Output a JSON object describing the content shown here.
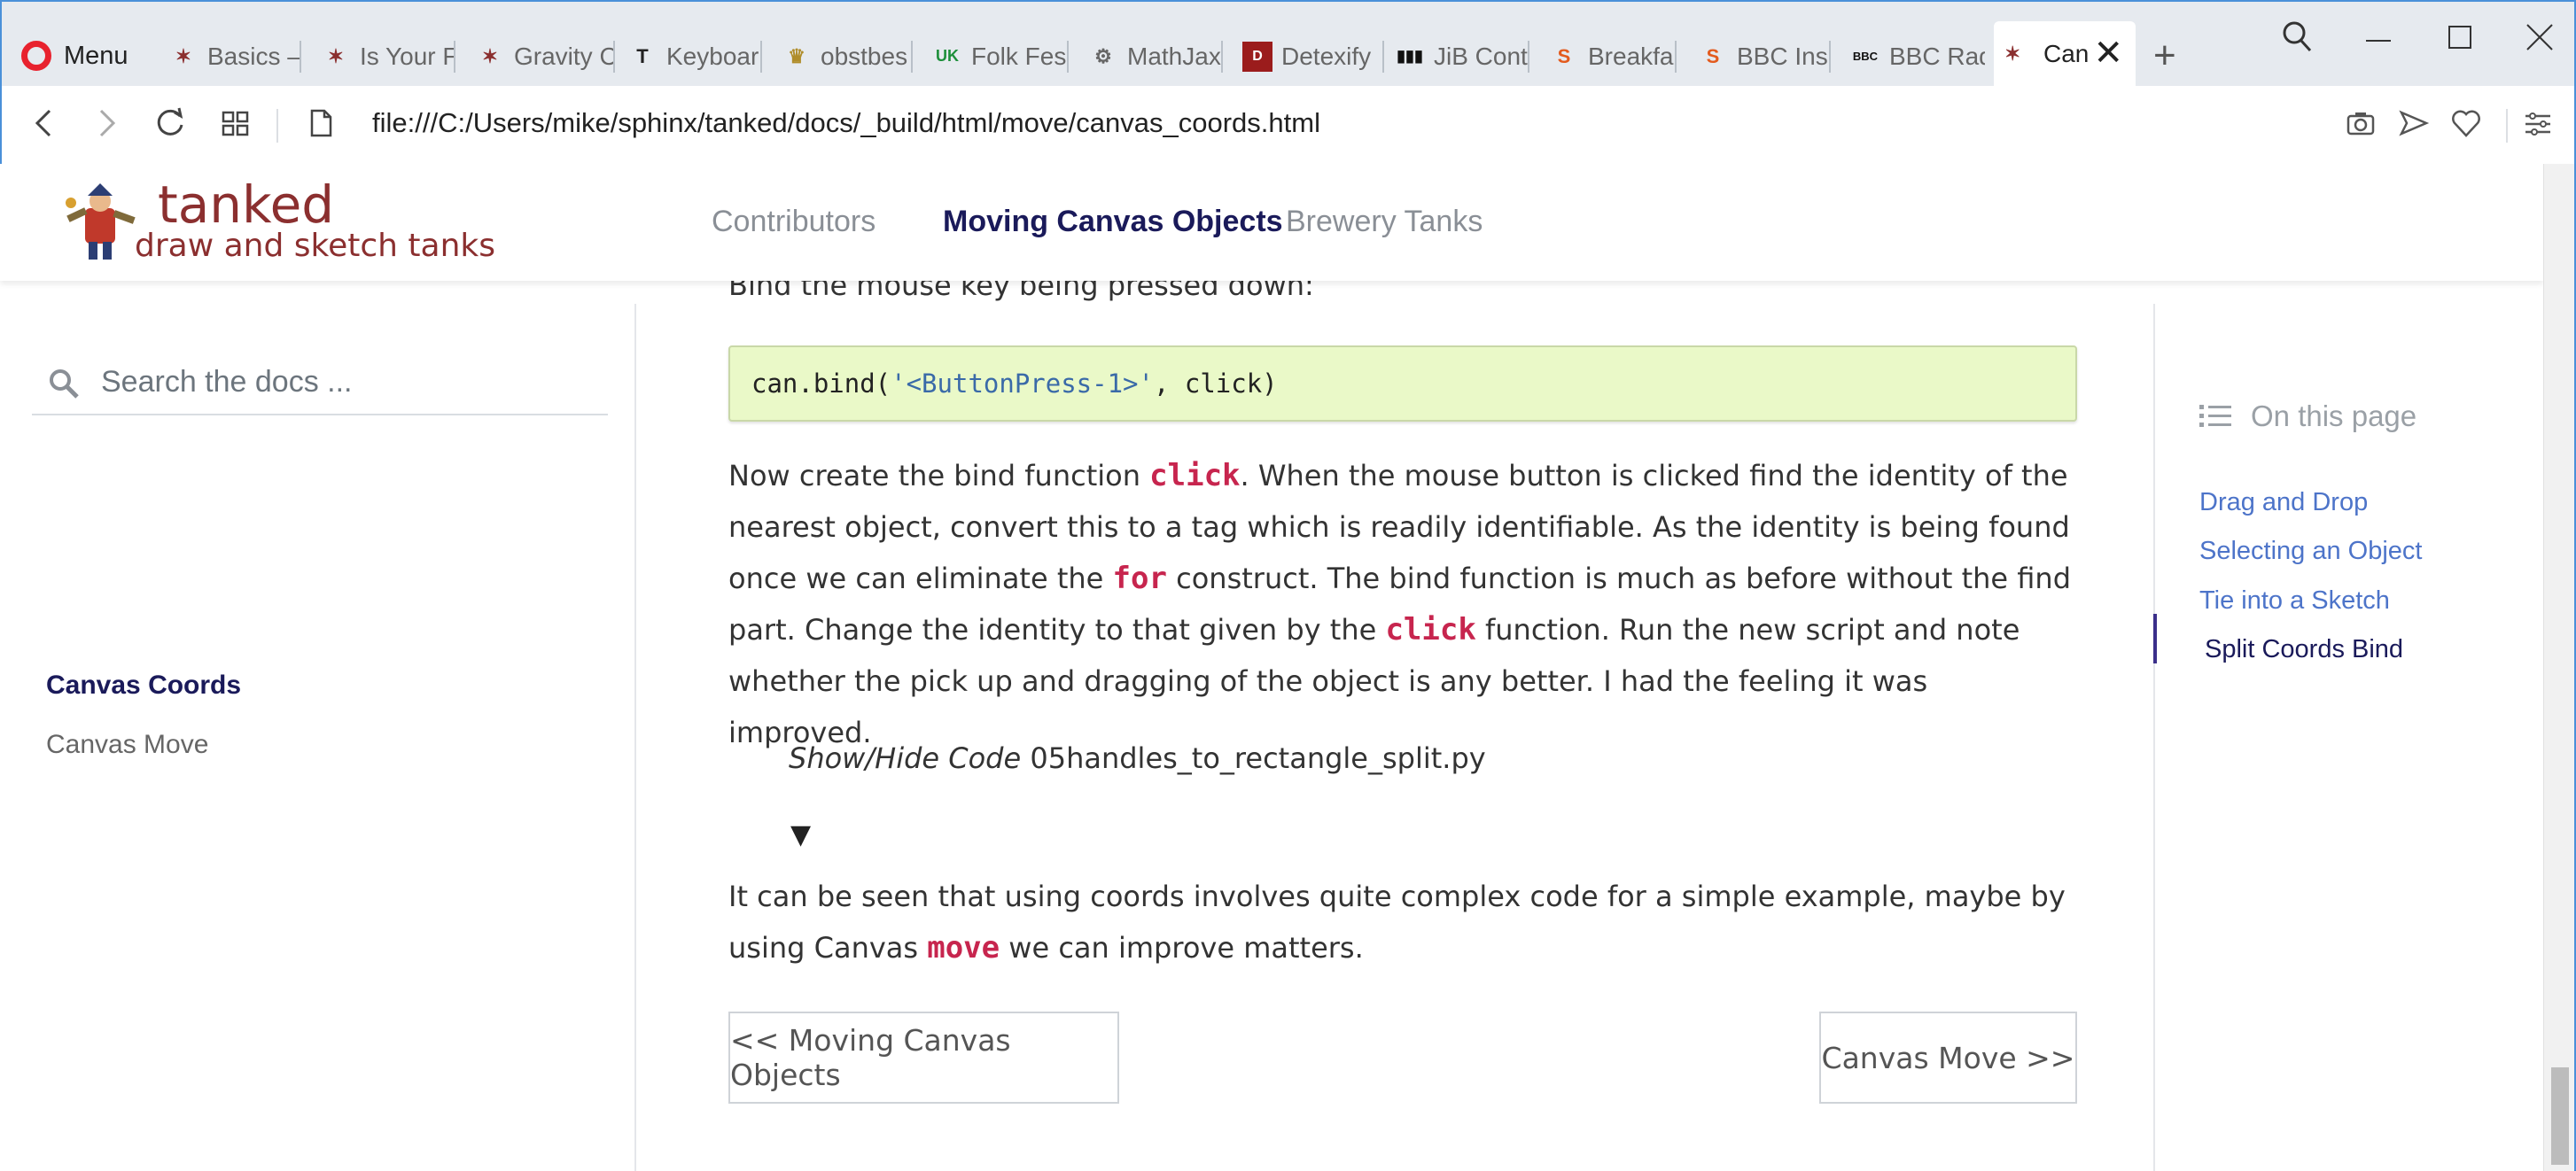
{
  "browser": {
    "menu_label": "Menu",
    "tabs": [
      {
        "label": "Basics –",
        "icon": "tanked-favicon"
      },
      {
        "label": "Is Your F",
        "icon": "tanked-favicon"
      },
      {
        "label": "Gravity C",
        "icon": "tanked-favicon"
      },
      {
        "label": "Keyboar",
        "icon": "typora-favicon"
      },
      {
        "label": "obstbes",
        "icon": "badge-favicon"
      },
      {
        "label": "Folk Fes",
        "icon": "ukff-favicon"
      },
      {
        "label": "MathJax",
        "icon": "gear-favicon"
      },
      {
        "label": "Detexify",
        "icon": "detexify-favicon"
      },
      {
        "label": "JiB Cont",
        "icon": "jib-favicon"
      },
      {
        "label": "Breakfa",
        "icon": "s-favicon"
      },
      {
        "label": "BBC Insi",
        "icon": "s-favicon"
      },
      {
        "label": "BBC Rad",
        "icon": "bbc-favicon"
      }
    ],
    "active_tab": {
      "label": "Can",
      "icon": "tanked-favicon"
    },
    "url": "file:///C:/Users/mike/sphinx/tanked/docs/_build/html/move/canvas_coords.html"
  },
  "site": {
    "logo_title": "tanked",
    "logo_subtitle": "draw and sketch tanks",
    "nav": [
      {
        "label": "Contributors",
        "active": false
      },
      {
        "label": "Moving Canvas Objects",
        "active": true
      },
      {
        "label": "Brewery Tanks",
        "active": false
      }
    ]
  },
  "sidebar": {
    "search_placeholder": "Search the docs ...",
    "items": [
      {
        "label": "Canvas Coords",
        "active": true
      },
      {
        "label": "Canvas Move",
        "active": false
      }
    ]
  },
  "content": {
    "intro": "Bind the mouse key being pressed down:",
    "code": {
      "prefix": "can.bind(",
      "string": "'<ButtonPress-1>'",
      "suffix": ", click)"
    },
    "para1": {
      "t1": "Now create the bind function ",
      "k1": "click",
      "t2": ". When the mouse button is clicked find the identity of the nearest object, convert this to a tag which is readily identifiable. As the identity is being found once we can eliminate the ",
      "k2": "for",
      "t3": " construct. The bind function is much as before without the find part. Change the identity to that given by the ",
      "k3": "click",
      "t4": " function. Run the new script and note whether the pick up and dragging of the object is any better. I had the feeling it was improved."
    },
    "showhide": {
      "label": "Show/Hide Code",
      "filename": "05handles_to_rectangle_split.py"
    },
    "para2": {
      "t1": "It can be seen that using coords involves quite complex code for a simple example, maybe by using Canvas ",
      "k1": "move",
      "t2": " we can improve matters."
    },
    "prev_label": "<< Moving Canvas Objects",
    "next_label": "Canvas Move >>"
  },
  "toc": {
    "title": "On this page",
    "items": [
      {
        "label": "Drag and Drop",
        "active": false
      },
      {
        "label": "Selecting an Object",
        "active": false
      },
      {
        "label": "Tie into a Sketch",
        "active": false
      },
      {
        "label": "Split Coords Bind",
        "active": true
      }
    ]
  },
  "colors": {
    "brand": "#8b2f2f",
    "nav_active": "#1a1a5a",
    "link": "#4d74c9",
    "keyword": "#c7254e",
    "code_bg": "#eaf9c8"
  }
}
